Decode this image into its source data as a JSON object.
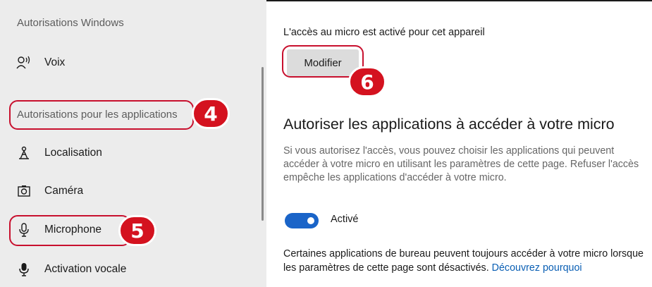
{
  "sidebar": {
    "heading_windows": "Autorisations Windows",
    "voice_label": "Voix",
    "heading_apps": "Autorisations pour les applications",
    "items": [
      {
        "label": "Localisation",
        "icon": "location-icon"
      },
      {
        "label": "Caméra",
        "icon": "camera-icon"
      },
      {
        "label": "Microphone",
        "icon": "microphone-icon"
      },
      {
        "label": "Activation vocale",
        "icon": "voice-activation-icon"
      }
    ]
  },
  "main": {
    "status_text": "L'accès au micro est activé pour cet appareil",
    "modify_button": "Modifier",
    "section_title": "Autoriser les applications à accéder à votre micro",
    "description": "Si vous autorisez l'accès, vous pouvez choisir les applications qui peuvent accéder à votre micro en utilisant les paramètres de cette page. Refuser l'accès empêche les applications d'accéder à votre micro.",
    "toggle": {
      "state": "on",
      "label": "Activé"
    },
    "note_text": "Certaines applications de bureau peuvent toujours accéder à votre micro lorsque les paramètres de cette page sont désactivés.",
    "note_link": "Découvrez pourquoi"
  },
  "annotations": {
    "badge_apps_permissions": "4",
    "badge_microphone": "5",
    "badge_modify": "6"
  },
  "colors": {
    "annotation_red": "#c8102e",
    "badge_red": "#d4121f",
    "toggle_blue": "#1a64c8",
    "link_blue": "#0a5fb4",
    "sidebar_bg": "#ececec"
  }
}
